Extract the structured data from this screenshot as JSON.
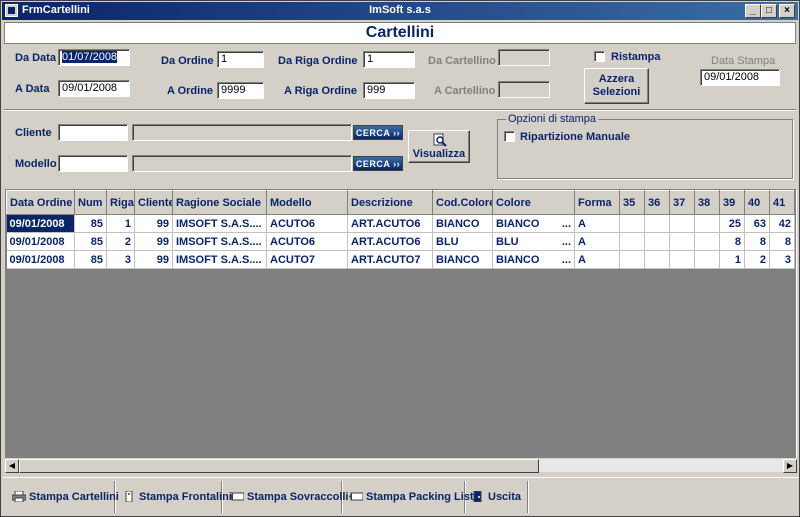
{
  "window": {
    "title": "FrmCartellini",
    "app_name": "ImSoft s.a.s",
    "min": "_",
    "max": "□",
    "close": "×"
  },
  "header": {
    "title": "Cartellini"
  },
  "filters": {
    "da_data_label": "Da Data",
    "da_data_value": "01/07/2008",
    "a_data_label": "A Data",
    "a_data_value": "09/01/2008",
    "da_ordine_label": "Da Ordine",
    "da_ordine_value": "1",
    "a_ordine_label": "A Ordine",
    "a_ordine_value": "9999",
    "da_riga_label": "Da Riga Ordine",
    "da_riga_value": "1",
    "a_riga_label": "A Riga Ordine",
    "a_riga_value": "999",
    "da_cartellino_label": "Da Cartellino",
    "a_cartellino_label": "A Cartellino",
    "ristampa_label": "Ristampa",
    "azzera_label_1": "Azzera",
    "azzera_label_2": "Selezioni",
    "data_stampa_label": "Data Stampa",
    "data_stampa_value": "09/01/2008"
  },
  "selection": {
    "cliente_label": "Cliente",
    "modello_label": "Modello",
    "cerca_label": "CERCA",
    "visualizza_label": "Visualizza",
    "opzioni_title": "Opzioni di stampa",
    "ripartizione_label": "Ripartizione Manuale"
  },
  "table": {
    "columns": [
      "Data Ordine",
      "Num",
      "Riga",
      "Cliente",
      "Ragione Sociale",
      "Modello",
      "Descrizione",
      "Cod.Colore",
      "Colore",
      "Forma",
      "35",
      "36",
      "37",
      "38",
      "39",
      "40",
      "41"
    ],
    "rows": [
      [
        "09/01/2008",
        "85",
        "1",
        "99",
        "IMSOFT S.A.S....",
        "ACUTO6",
        "ART.ACUTO6",
        "BIANCO",
        "BIANCO",
        "A",
        "",
        "",
        "",
        "",
        "25",
        "63",
        "42"
      ],
      [
        "09/01/2008",
        "85",
        "2",
        "99",
        "IMSOFT S.A.S....",
        "ACUTO6",
        "ART.ACUTO6",
        "BLU",
        "BLU",
        "A",
        "",
        "",
        "",
        "",
        "8",
        "8",
        "8"
      ],
      [
        "09/01/2008",
        "85",
        "3",
        "99",
        "IMSOFT S.A.S....",
        "ACUTO7",
        "ART.ACUTO7",
        "BIANCO",
        "BIANCO",
        "A",
        "",
        "",
        "",
        "",
        "1",
        "2",
        "3"
      ]
    ]
  },
  "toolbar": {
    "stampa_cartellini": "Stampa Cartellini",
    "stampa_frontalini": "Stampa Frontalini",
    "stampa_sovraccolli": "Stampa Sovraccolli",
    "stampa_packing": "Stampa Packing List",
    "uscita": "Uscita"
  }
}
